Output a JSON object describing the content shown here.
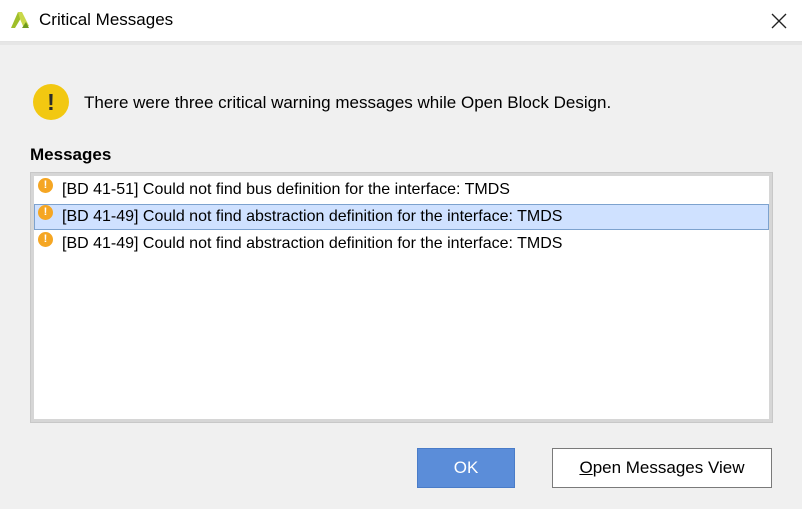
{
  "window": {
    "title": "Critical Messages",
    "close_icon": "close-icon",
    "app_icon": "vivado-logo-icon"
  },
  "summary": {
    "text": "There were three critical warning messages while Open Block Design.",
    "icon": "warning-icon",
    "icon_color": "#f2c811"
  },
  "messages": {
    "heading": "Messages",
    "items": [
      {
        "text": "[BD 41-51] Could not find bus definition for the interface: TMDS",
        "selected": false
      },
      {
        "text": "[BD 41-49] Could not find abstraction definition for the interface: TMDS",
        "selected": true
      },
      {
        "text": "[BD 41-49] Could not find abstraction definition for the interface: TMDS",
        "selected": false
      }
    ],
    "item_icon_color": "#f5a623",
    "selection_color": "#cfe1ff"
  },
  "buttons": {
    "ok_label": "OK",
    "open_view_label_first": "O",
    "open_view_label_rest": "pen Messages View"
  },
  "colors": {
    "primary_button": "#5b8dd9"
  }
}
